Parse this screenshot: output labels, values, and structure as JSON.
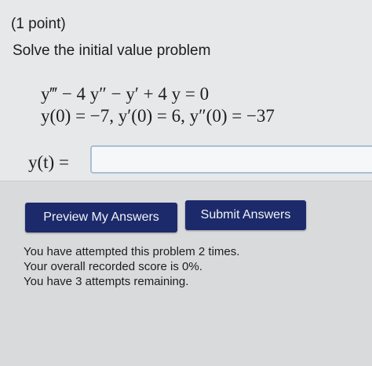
{
  "problem": {
    "points": "(1 point)",
    "instruction": "Solve the initial value problem",
    "equation": "y‴ − 4 y″ − y′ + 4 y = 0",
    "conditions": "y(0) = −7,   y′(0) = 6,   y″(0) = −37"
  },
  "answer": {
    "label": "y(t)  =",
    "value": ""
  },
  "buttons": {
    "preview": "Preview My Answers",
    "submit": "Submit Answers"
  },
  "status": {
    "attempts": "You have attempted this problem 2 times.",
    "score": "Your overall recorded score is 0%.",
    "remaining": "You have 3 attempts remaining."
  },
  "colors": {
    "button": "#1c2a6b",
    "input_border": "#a9bfd6",
    "panel": "#e7e8ea"
  }
}
